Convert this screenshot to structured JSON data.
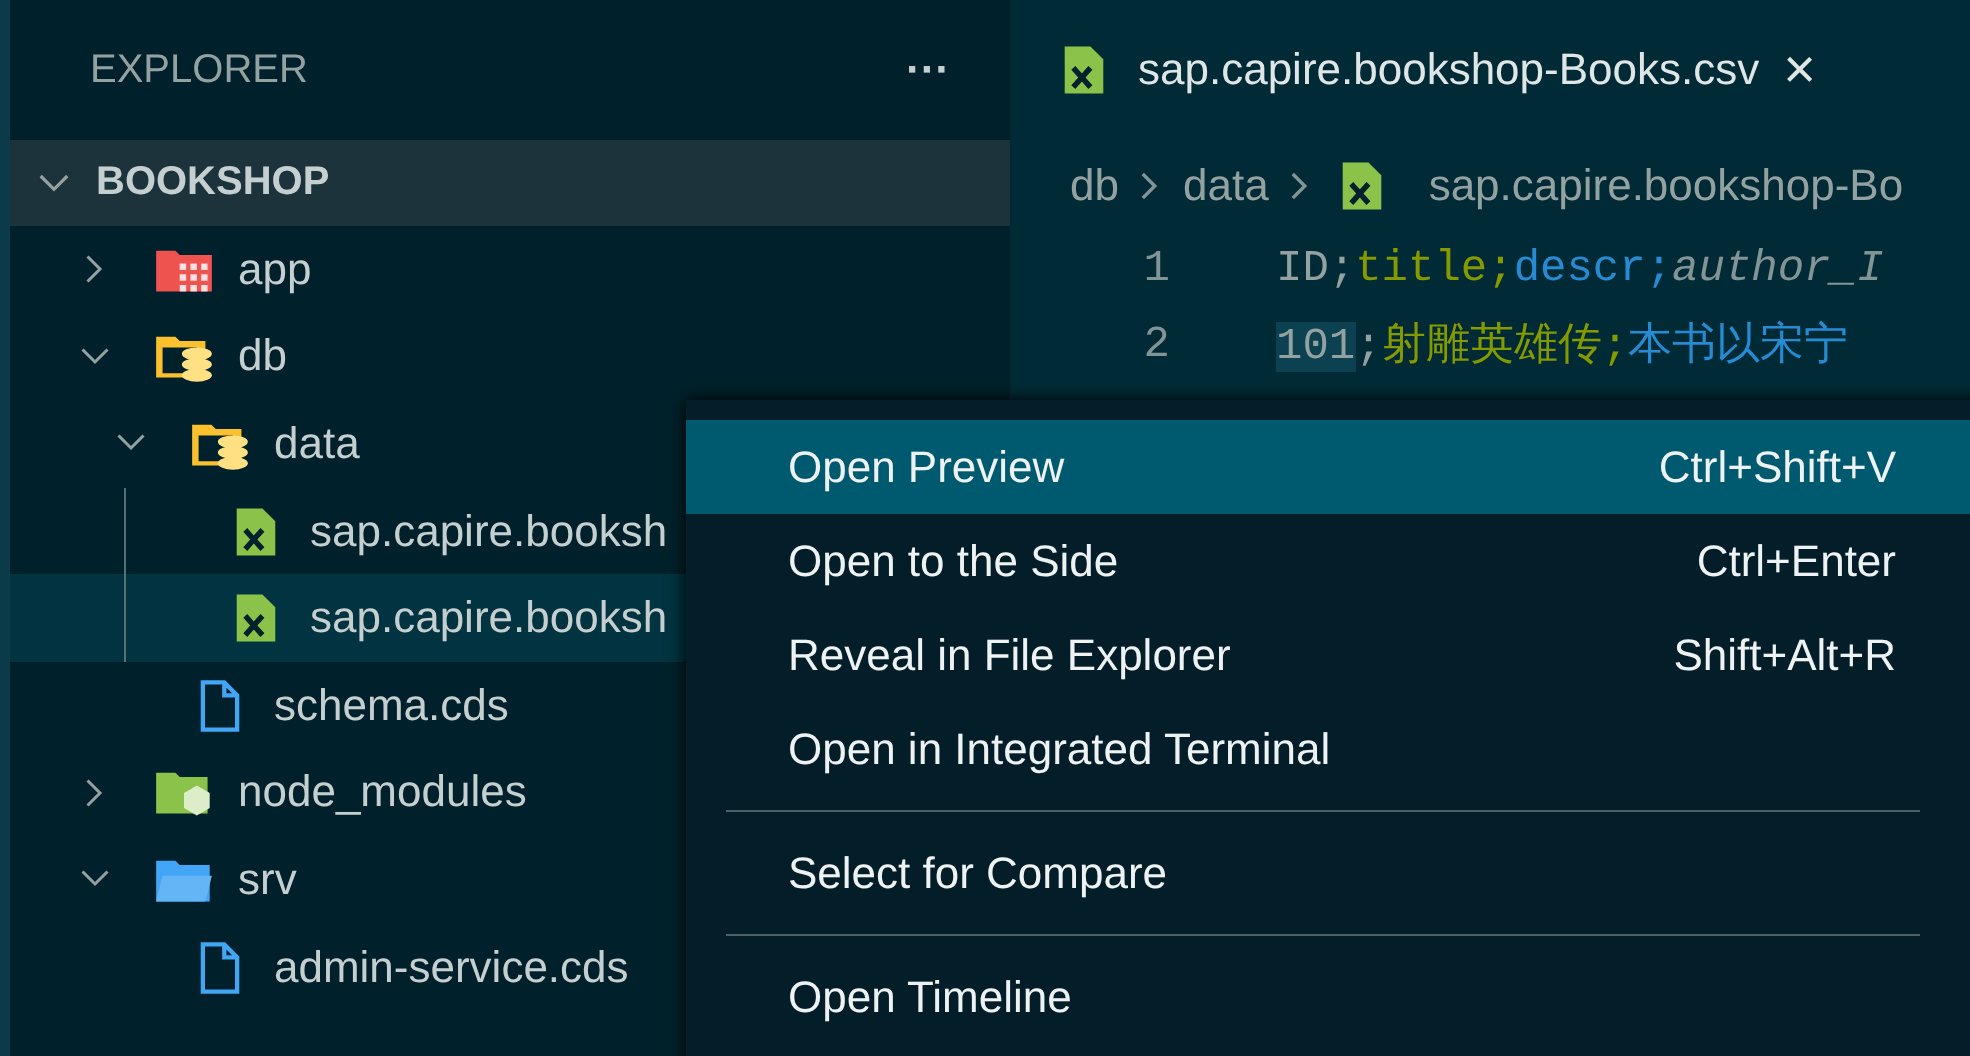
{
  "sidebar": {
    "title": "EXPLORER",
    "more": "···",
    "section": {
      "label": "BOOKSHOP",
      "expanded": true
    },
    "tree": [
      {
        "name": "app",
        "kind": "app-folder",
        "expanded": false,
        "selected": false
      },
      {
        "name": "db",
        "kind": "db-folder",
        "expanded": true,
        "selected": false,
        "children": [
          {
            "name": "data",
            "kind": "db-folder",
            "expanded": true,
            "selected": false,
            "children": [
              {
                "name": "sap.capire.booksh",
                "kind": "csv",
                "selected": false
              },
              {
                "name": "sap.capire.booksh",
                "kind": "csv",
                "selected": true
              }
            ]
          },
          {
            "name": "schema.cds",
            "kind": "file",
            "selected": false
          }
        ]
      },
      {
        "name": "node_modules",
        "kind": "node-folder",
        "expanded": false,
        "selected": false
      },
      {
        "name": "srv",
        "kind": "folder",
        "expanded": true,
        "selected": false,
        "children": [
          {
            "name": "admin-service.cds",
            "kind": "file",
            "selected": false
          }
        ]
      }
    ]
  },
  "editor": {
    "tab": {
      "label": "sap.capire.bookshop-Books.csv",
      "close": "×"
    },
    "breadcrumbs": [
      "db",
      "data",
      "sap.capire.bookshop-Bo"
    ],
    "lines": [
      {
        "number": "1",
        "tokens": [
          {
            "text": "ID;",
            "color": "#93a1a1",
            "italic": false,
            "highlighted": false
          },
          {
            "text": "title;",
            "color": "#859900",
            "italic": false,
            "highlighted": false
          },
          {
            "text": "descr;",
            "color": "#268bd2",
            "italic": false,
            "highlighted": false
          },
          {
            "text": "author_I",
            "color": "#839496",
            "italic": true,
            "highlighted": false
          }
        ]
      },
      {
        "number": "2",
        "tokens": [
          {
            "text": "101",
            "color": "#93a1a1",
            "italic": false,
            "highlighted": true
          },
          {
            "text": ";",
            "color": "#93a1a1",
            "italic": false,
            "highlighted": false
          },
          {
            "text": "射雕英雄传;",
            "color": "#859900",
            "italic": false,
            "highlighted": false
          },
          {
            "text": "本书以宋宁",
            "color": "#268bd2",
            "italic": false,
            "highlighted": false
          }
        ]
      }
    ]
  },
  "context_menu": {
    "groups": [
      [
        {
          "label": "Open Preview",
          "shortcut": "Ctrl+Shift+V",
          "selected": true
        },
        {
          "label": "Open to the Side",
          "shortcut": "Ctrl+Enter",
          "selected": false
        },
        {
          "label": "Reveal in File Explorer",
          "shortcut": "Shift+Alt+R",
          "selected": false
        },
        {
          "label": "Open in Integrated Terminal",
          "selected": false
        }
      ],
      [
        {
          "label": "Select for Compare",
          "selected": false
        }
      ],
      [
        {
          "label": "Open Timeline",
          "selected": false
        }
      ]
    ]
  }
}
